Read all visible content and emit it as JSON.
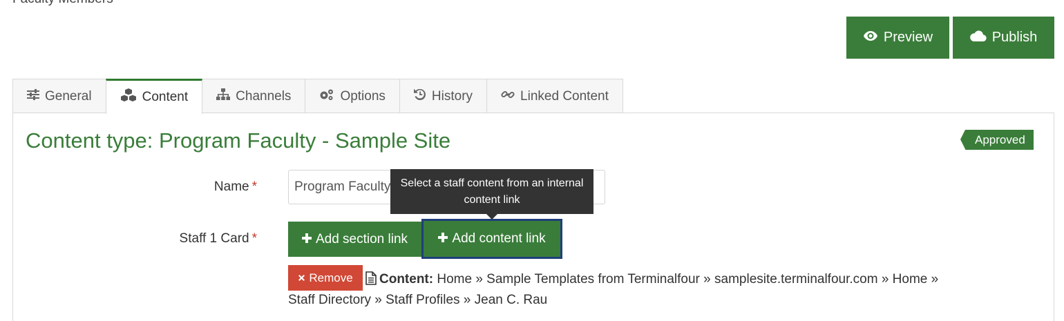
{
  "header": {
    "breadcrumb_partial": "Faculty Members",
    "preview_label": "Preview",
    "publish_label": "Publish"
  },
  "tabs": [
    {
      "label": "General",
      "icon": "sliders-icon"
    },
    {
      "label": "Content",
      "icon": "cubes-icon",
      "active": true
    },
    {
      "label": "Channels",
      "icon": "sitemap-icon"
    },
    {
      "label": "Options",
      "icon": "gears-icon"
    },
    {
      "label": "History",
      "icon": "history-icon"
    },
    {
      "label": "Linked Content",
      "icon": "link-icon"
    }
  ],
  "main": {
    "title": "Content type: Program Faculty - Sample Site",
    "status_badge": "Approved",
    "fields": {
      "name_label": "Name",
      "name_value": "Program Faculty",
      "staff_label": "Staff 1 Card",
      "required_mark": "*"
    },
    "tooltip": "Select a staff content from an internal content link",
    "add_section_label": "Add section link",
    "add_content_label": "Add content link",
    "remove_label": "Remove",
    "content_link": {
      "lead": "Content:",
      "path_line1": "Home » Sample Templates from Terminalfour » samplesite.terminalfour.com » Home »",
      "path_line2": "Staff Directory » Staff Profiles » Jean C. Rau"
    }
  },
  "colors": {
    "primary_green": "#3a7d3a",
    "danger_red": "#d14836",
    "tooltip_bg": "#333333",
    "focus_outline": "#1f3f7a"
  }
}
